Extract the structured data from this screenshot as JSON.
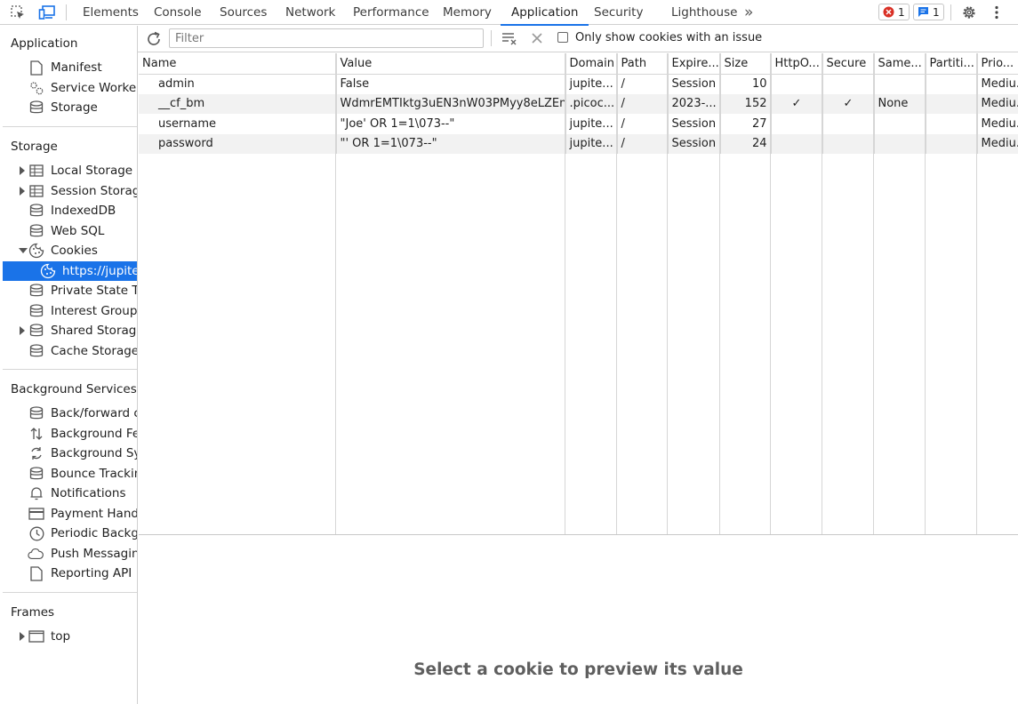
{
  "topbar": {
    "tabs": [
      "Elements",
      "Console",
      "Sources",
      "Network",
      "Performance",
      "Memory",
      "Application",
      "Security",
      "Lighthouse"
    ],
    "active_tab": "Application",
    "more_tabs_glyph": "»",
    "error_count": "1",
    "message_count": "1"
  },
  "sidebar": {
    "application_title": "Application",
    "application_items": [
      "Manifest",
      "Service Workers",
      "Storage"
    ],
    "storage_title": "Storage",
    "storage_items": [
      "Local Storage",
      "Session Storage",
      "IndexedDB",
      "Web SQL",
      "Cookies",
      "https://jupiter",
      "Private State Tok",
      "Interest Groups",
      "Shared Storage",
      "Cache Storage"
    ],
    "background_title": "Background Services",
    "background_items": [
      "Back/forward ca",
      "Background Fetc",
      "Background Syn",
      "Bounce Tracking",
      "Notifications",
      "Payment Handle",
      "Periodic Backgro",
      "Push Messaging",
      "Reporting API"
    ],
    "frames_title": "Frames",
    "frames_items": [
      "top"
    ]
  },
  "toolbar": {
    "filter_placeholder": "Filter",
    "filter_value": "",
    "only_issues_label": "Only show cookies with an issue",
    "only_issues_checked": false
  },
  "table": {
    "columns": [
      "Name",
      "Value",
      "Domain",
      "Path",
      "Expire...",
      "Size",
      "HttpO...",
      "Secure",
      "Same...",
      "Partiti...",
      "Prio..."
    ],
    "rows": [
      {
        "name": "admin",
        "value": "False",
        "domain": "jupite...",
        "path": "/",
        "expires": "Session",
        "size": "10",
        "httponly": "",
        "secure": "",
        "samesite": "",
        "partition": "",
        "priority": "Mediu..."
      },
      {
        "name": "__cf_bm",
        "value": "WdmrEMTIktg3uEN3nW03PMyy8eLZEn...",
        "domain": ".picoc...",
        "path": "/",
        "expires": "2023-...",
        "size": "152",
        "httponly": "✓",
        "secure": "✓",
        "samesite": "None",
        "partition": "",
        "priority": "Mediu..."
      },
      {
        "name": "username",
        "value": "\"Joe' OR 1=1\\073--\"",
        "domain": "jupite...",
        "path": "/",
        "expires": "Session",
        "size": "27",
        "httponly": "",
        "secure": "",
        "samesite": "",
        "partition": "",
        "priority": "Mediu..."
      },
      {
        "name": "password",
        "value": "\"' OR 1=1\\073--\"",
        "domain": "jupite...",
        "path": "/",
        "expires": "Session",
        "size": "24",
        "httponly": "",
        "secure": "",
        "samesite": "",
        "partition": "",
        "priority": "Mediu..."
      }
    ]
  },
  "preview": {
    "message": "Select a cookie to preview its value"
  },
  "colors": {
    "accent": "#1a73e8",
    "error": "#d93025",
    "border": "#d0d0d0"
  }
}
